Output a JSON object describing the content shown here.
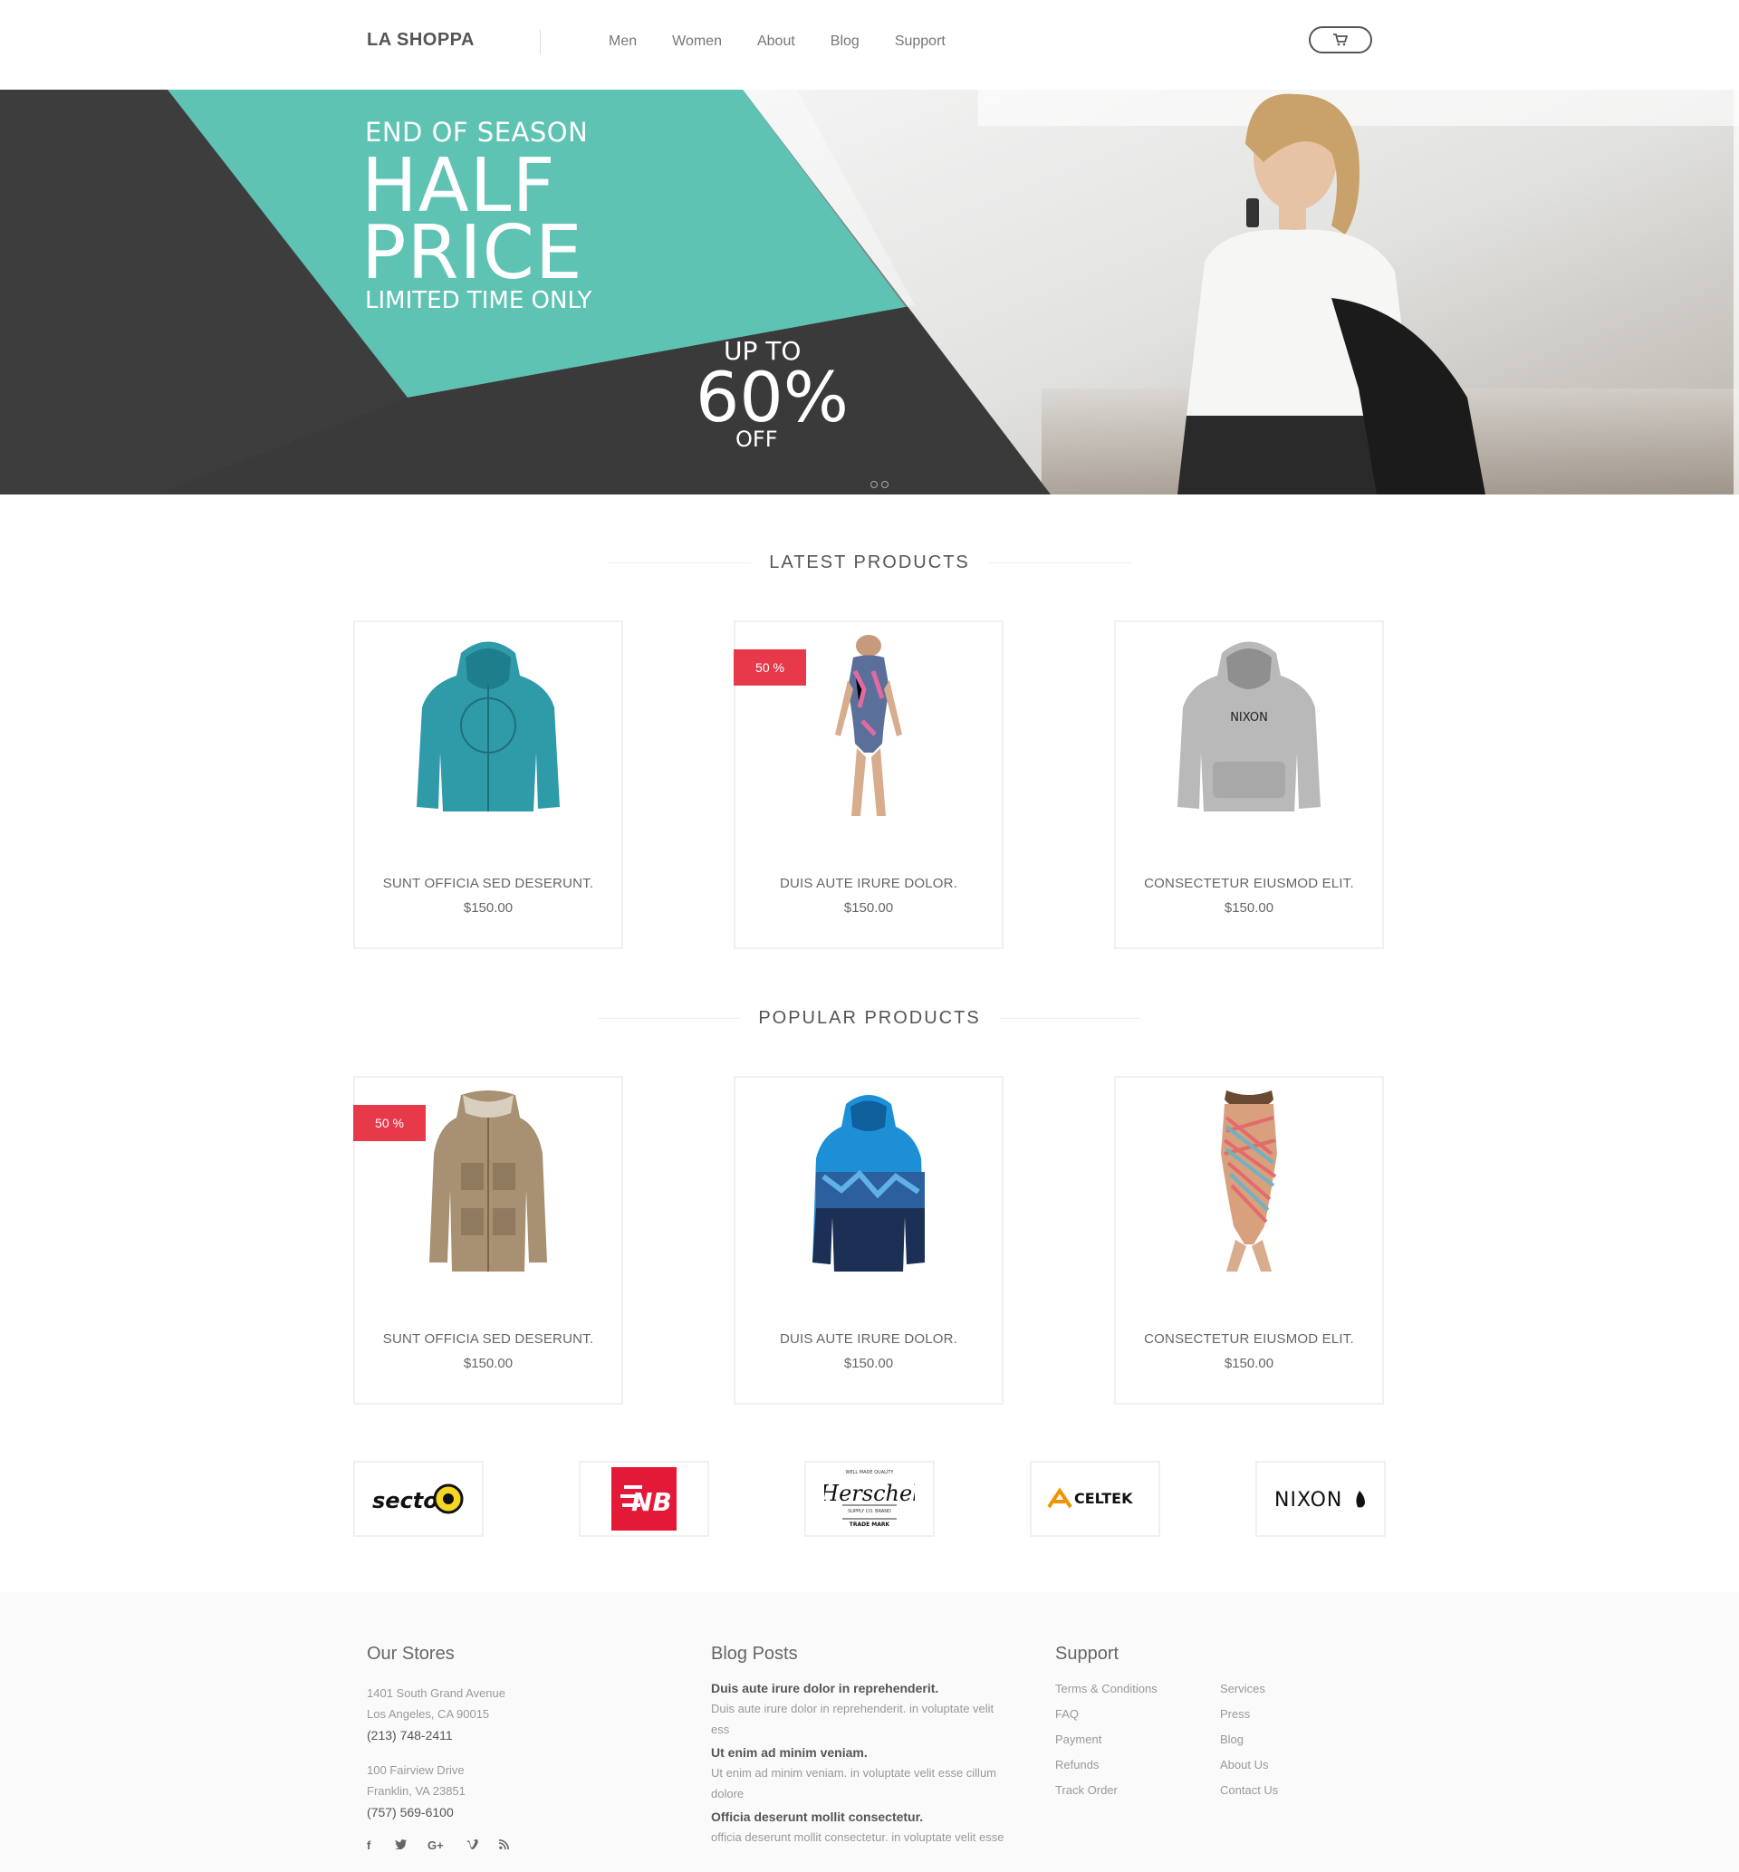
{
  "header": {
    "logo": "LA SHOPPA",
    "nav": [
      "Men",
      "Women",
      "About",
      "Blog",
      "Support"
    ]
  },
  "hero": {
    "eyebrow": "END OF SEASON",
    "big_line1": "HALF",
    "big_line2": "PRICE",
    "sub": "LIMITED TIME ONLY",
    "upto": "UP TO",
    "percent": "60%",
    "off": "OFF",
    "colors": {
      "teal": "#5fc3b4",
      "dark": "#3d3d3e"
    }
  },
  "latest": {
    "title": "LATEST PRODUCTS",
    "products": [
      {
        "name": "SUNT OFFICIA SED DESERUNT.",
        "price": "$150.00",
        "image": "teal-hoodie",
        "badge": ""
      },
      {
        "name": "DUIS AUTE IRURE DOLOR.",
        "price": "$150.00",
        "image": "floral-swimsuit",
        "badge": "50 %"
      },
      {
        "name": "CONSECTETUR EIUSMOD ELIT.",
        "price": "$150.00",
        "image": "grey-nixon-hoodie",
        "badge": ""
      }
    ]
  },
  "popular": {
    "title": "POPULAR PRODUCTS",
    "products": [
      {
        "name": "SUNT OFFICIA SED DESERUNT.",
        "price": "$150.00",
        "image": "khaki-parka",
        "badge": "50 %"
      },
      {
        "name": "DUIS AUTE IRURE DOLOR.",
        "price": "$150.00",
        "image": "blue-camo-jacket",
        "badge": ""
      },
      {
        "name": "CONSECTETUR EIUSMOD ELIT.",
        "price": "$150.00",
        "image": "striped-swimsuit",
        "badge": ""
      }
    ]
  },
  "brands": {
    "sector": "sector9",
    "newbalance": "NB",
    "herschel": "Herschel",
    "herschel_small1": "WELL MADE QUALITY",
    "herschel_small2": "SUPPLY CO. BRAND",
    "herschel_small3": "TRADE MARK",
    "celtek": "CELTEK",
    "nixon": "NIXON"
  },
  "badge_color": "#e8394b",
  "footer": {
    "stores": {
      "title": "Our Stores",
      "store1": {
        "line1": "1401 South Grand Avenue",
        "line2": "Los Angeles, CA 90015",
        "phone": "(213) 748-2411"
      },
      "store2": {
        "line1": "100 Fairview Drive",
        "line2": "Franklin, VA 23851",
        "phone": "(757) 569-6100"
      }
    },
    "blog": {
      "title": "Blog Posts",
      "posts": [
        {
          "title": "Duis aute irure dolor in reprehenderit.",
          "excerpt1": "Duis aute irure dolor in reprehenderit. in voluptate velit",
          "excerpt2": "ess"
        },
        {
          "title": "Ut enim ad minim veniam.",
          "excerpt1": "Ut enim ad minim veniam. in voluptate velit esse cillum",
          "excerpt2": "dolore"
        },
        {
          "title": "Officia deserunt mollit consectetur.",
          "excerpt1": "officia deserunt mollit consectetur. in voluptate velit esse",
          "excerpt2": ""
        }
      ]
    },
    "support": {
      "title": "Support",
      "col1": [
        "Terms & Conditions",
        "FAQ",
        "Payment",
        "Refunds",
        "Track Order"
      ],
      "col2": [
        "Services",
        "Press",
        "Blog",
        "About Us",
        "Contact Us"
      ]
    },
    "social": [
      "f",
      "twitter-icon",
      "G+",
      "vimeo-icon",
      "rss-icon"
    ]
  }
}
